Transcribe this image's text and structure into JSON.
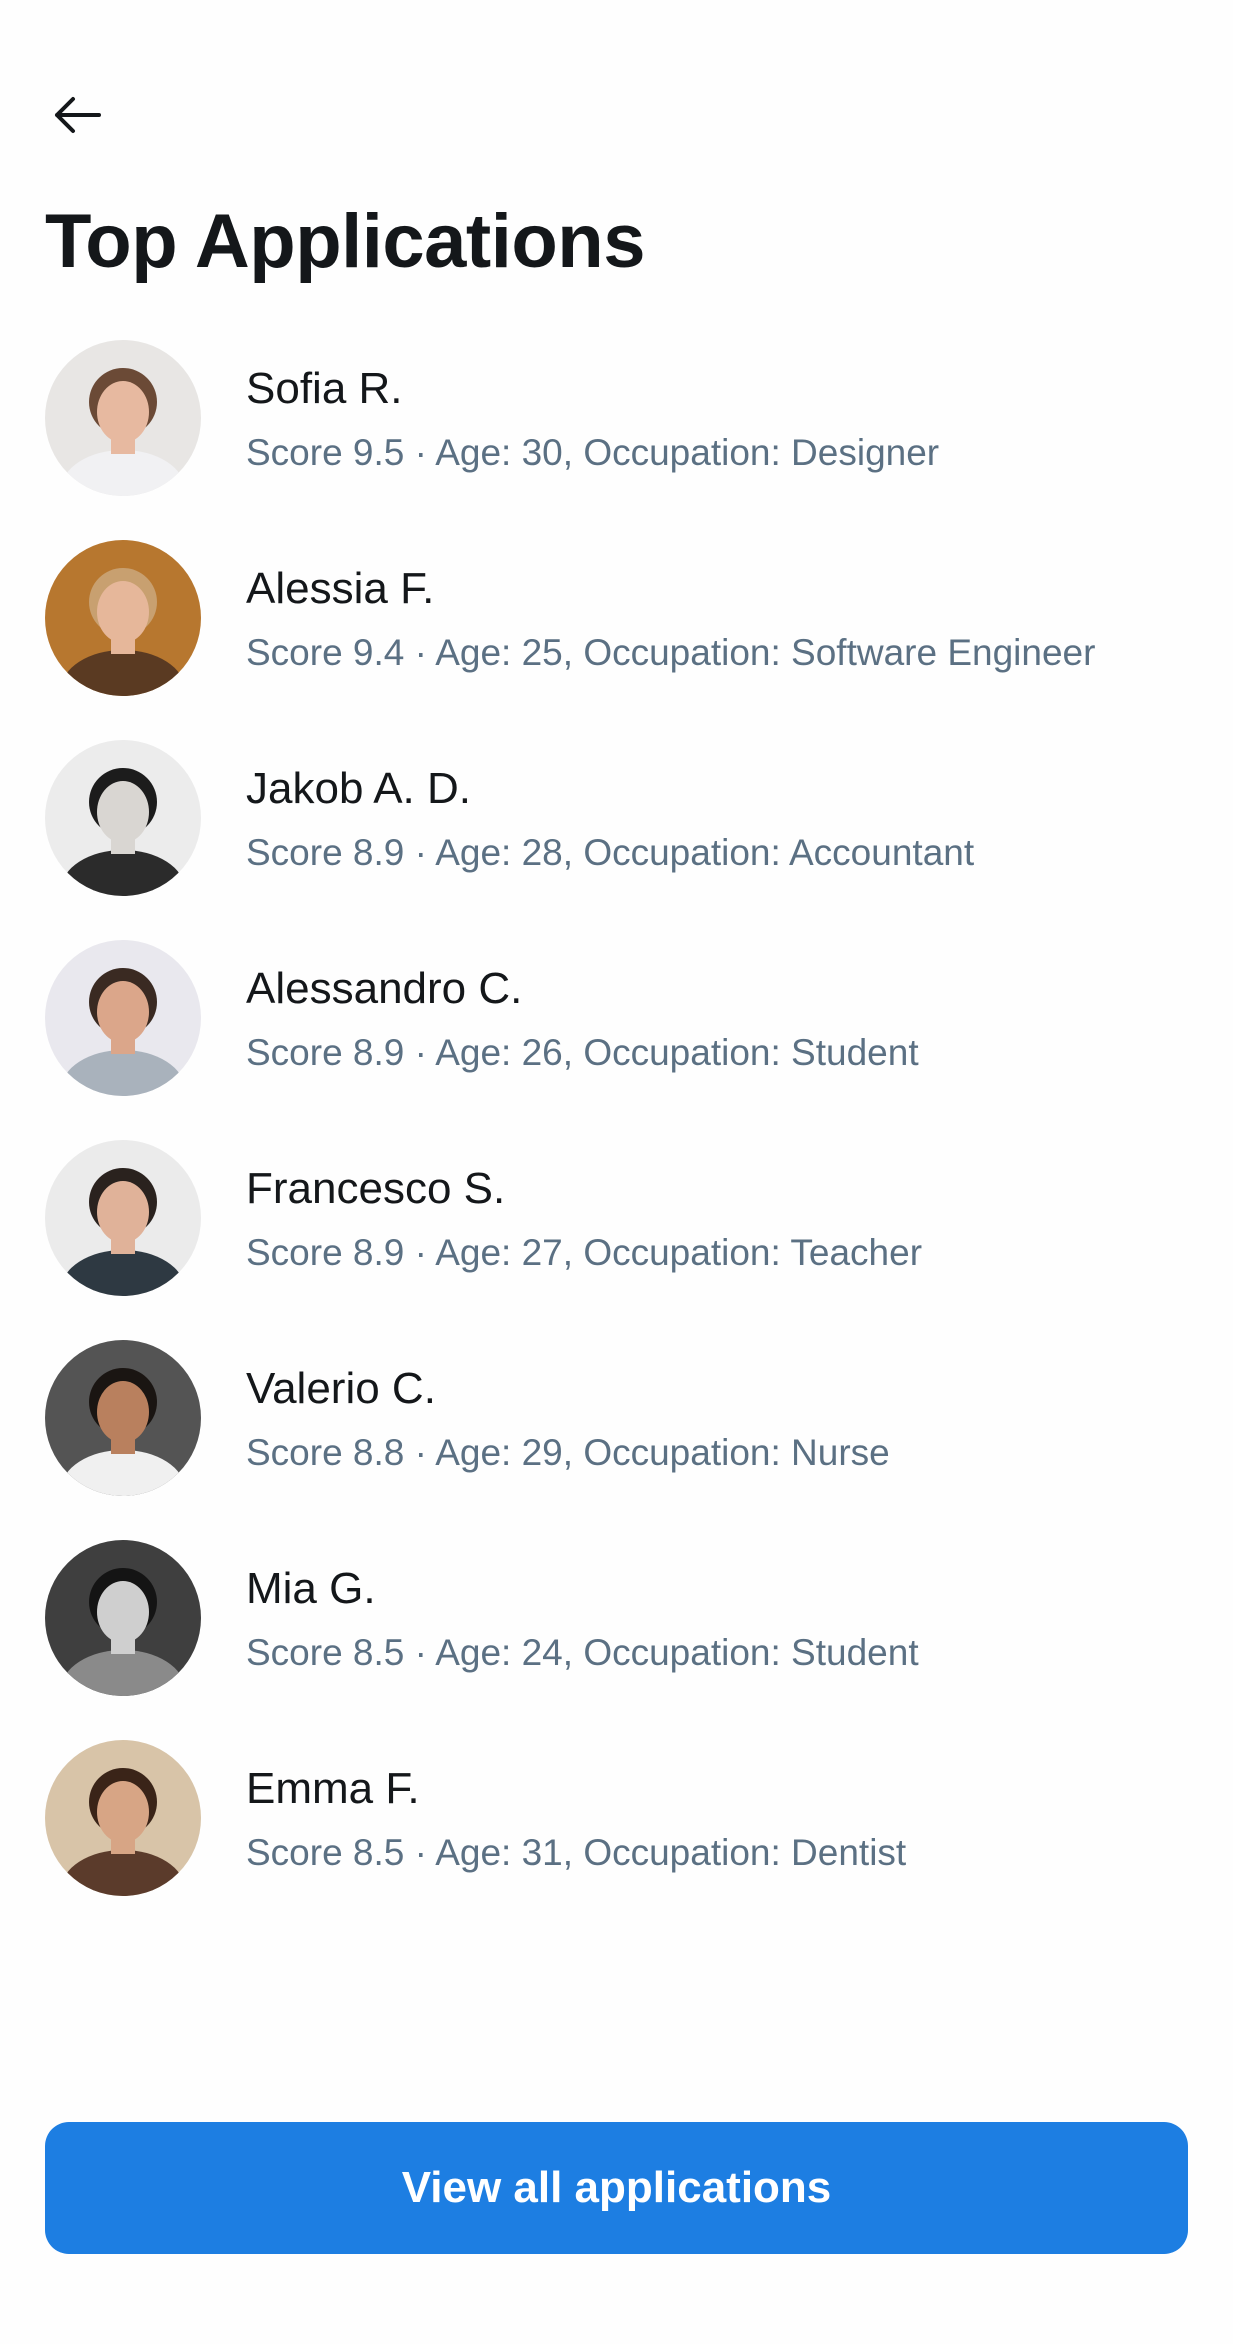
{
  "header": {
    "back_icon": "arrow-left-icon",
    "title": "Top Applications"
  },
  "applications": [
    {
      "name": "Sofia R.",
      "details": "Score 9.5 · Age: 30, Occupation: Designer",
      "bg": "#e8e6e4",
      "skin": "#e7b9a0",
      "hair": "#6b4a36",
      "shirt": "#f1f1f3"
    },
    {
      "name": "Alessia F.",
      "details": "Score 9.4 · Age: 25, Occupation: Software Engineer",
      "bg": "#b7772f",
      "skin": "#e6b79a",
      "hair": "#c8a070",
      "shirt": "#5a3a22"
    },
    {
      "name": "Jakob A. D.",
      "details": "Score 8.9 · Age: 28, Occupation: Accountant",
      "bg": "#ececec",
      "skin": "#d9d6d2",
      "hair": "#1c1c1c",
      "shirt": "#2b2b2b"
    },
    {
      "name": "Alessandro C.",
      "details": "Score 8.9 · Age: 26, Occupation: Student",
      "bg": "#e9e8ee",
      "skin": "#dba68a",
      "hair": "#3a2a22",
      "shirt": "#a9b2bc"
    },
    {
      "name": "Francesco S.",
      "details": "Score 8.9 · Age: 27, Occupation: Teacher",
      "bg": "#ebebeb",
      "skin": "#e0b299",
      "hair": "#2a221e",
      "shirt": "#2e3942"
    },
    {
      "name": "Valerio C.",
      "details": "Score 8.8 · Age: 29, Occupation: Nurse",
      "bg": "#545454",
      "skin": "#b9805e",
      "hair": "#1a1512",
      "shirt": "#f0f0f0"
    },
    {
      "name": "Mia G.",
      "details": "Score 8.5 · Age: 24, Occupation: Student",
      "bg": "#3f3f3f",
      "skin": "#cfcfcf",
      "hair": "#141414",
      "shirt": "#8a8a8a"
    },
    {
      "name": "Emma F.",
      "details": "Score 8.5 · Age: 31, Occupation: Dentist",
      "bg": "#d8c4a8",
      "skin": "#d7a585",
      "hair": "#3a2418",
      "shirt": "#5b3b2b"
    }
  ],
  "footer": {
    "view_all_label": "View all applications"
  },
  "colors": {
    "accent": "#1d7ee2",
    "secondary_text": "#5b7083"
  }
}
